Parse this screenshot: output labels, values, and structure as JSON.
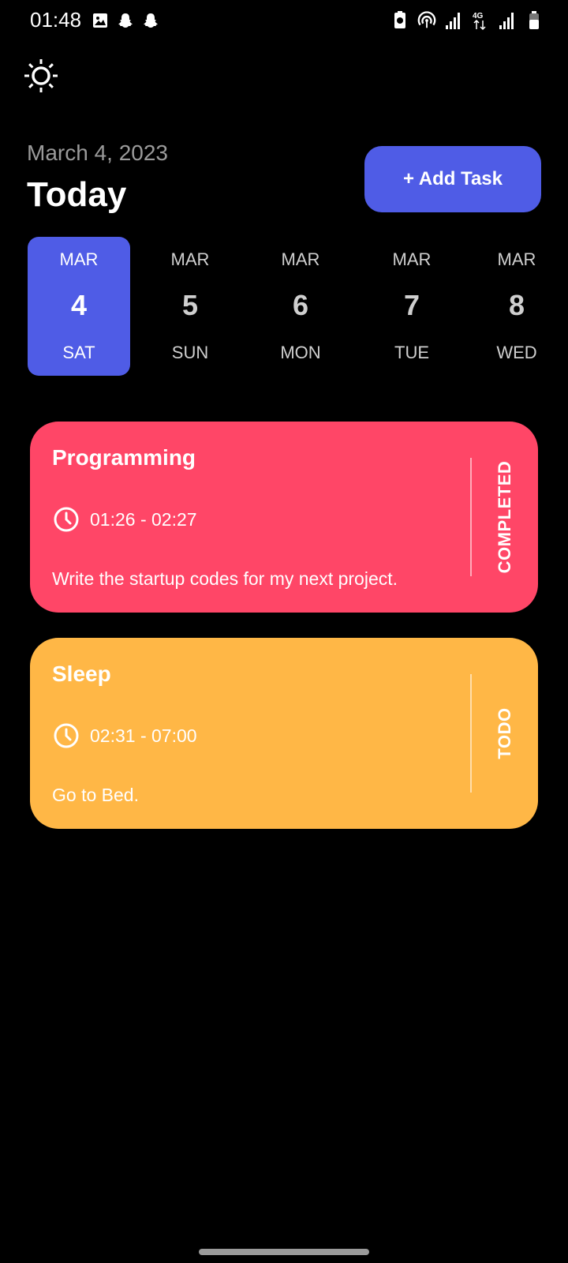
{
  "status_bar": {
    "time": "01:48",
    "left_icons": [
      "image-icon",
      "snapchat-icon",
      "snapchat-icon"
    ],
    "right_icons": [
      "battery-saver-icon",
      "hotspot-icon",
      "signal-icon",
      "4g-icon",
      "signal-icon",
      "battery-icon"
    ]
  },
  "header": {
    "theme_icon": "sun-icon",
    "date": "March 4, 2023",
    "title": "Today",
    "add_task_label": "+ Add Task"
  },
  "date_strip": {
    "selected_index": 0,
    "items": [
      {
        "month": "MAR",
        "day": "4",
        "weekday": "SAT"
      },
      {
        "month": "MAR",
        "day": "5",
        "weekday": "SUN"
      },
      {
        "month": "MAR",
        "day": "6",
        "weekday": "MON"
      },
      {
        "month": "MAR",
        "day": "7",
        "weekday": "TUE"
      },
      {
        "month": "MAR",
        "day": "8",
        "weekday": "WED"
      }
    ]
  },
  "tasks": [
    {
      "title": "Programming",
      "time": "01:26 - 02:27",
      "description": "Write the startup codes for my next project.",
      "status": "COMPLETED",
      "color": "#ff4667"
    },
    {
      "title": "Sleep",
      "time": "02:31 - 07:00",
      "description": "Go to Bed.",
      "status": "TODO",
      "color": "#ffb746"
    }
  ],
  "colors": {
    "accent": "#4f5ce6",
    "background": "#000000"
  }
}
